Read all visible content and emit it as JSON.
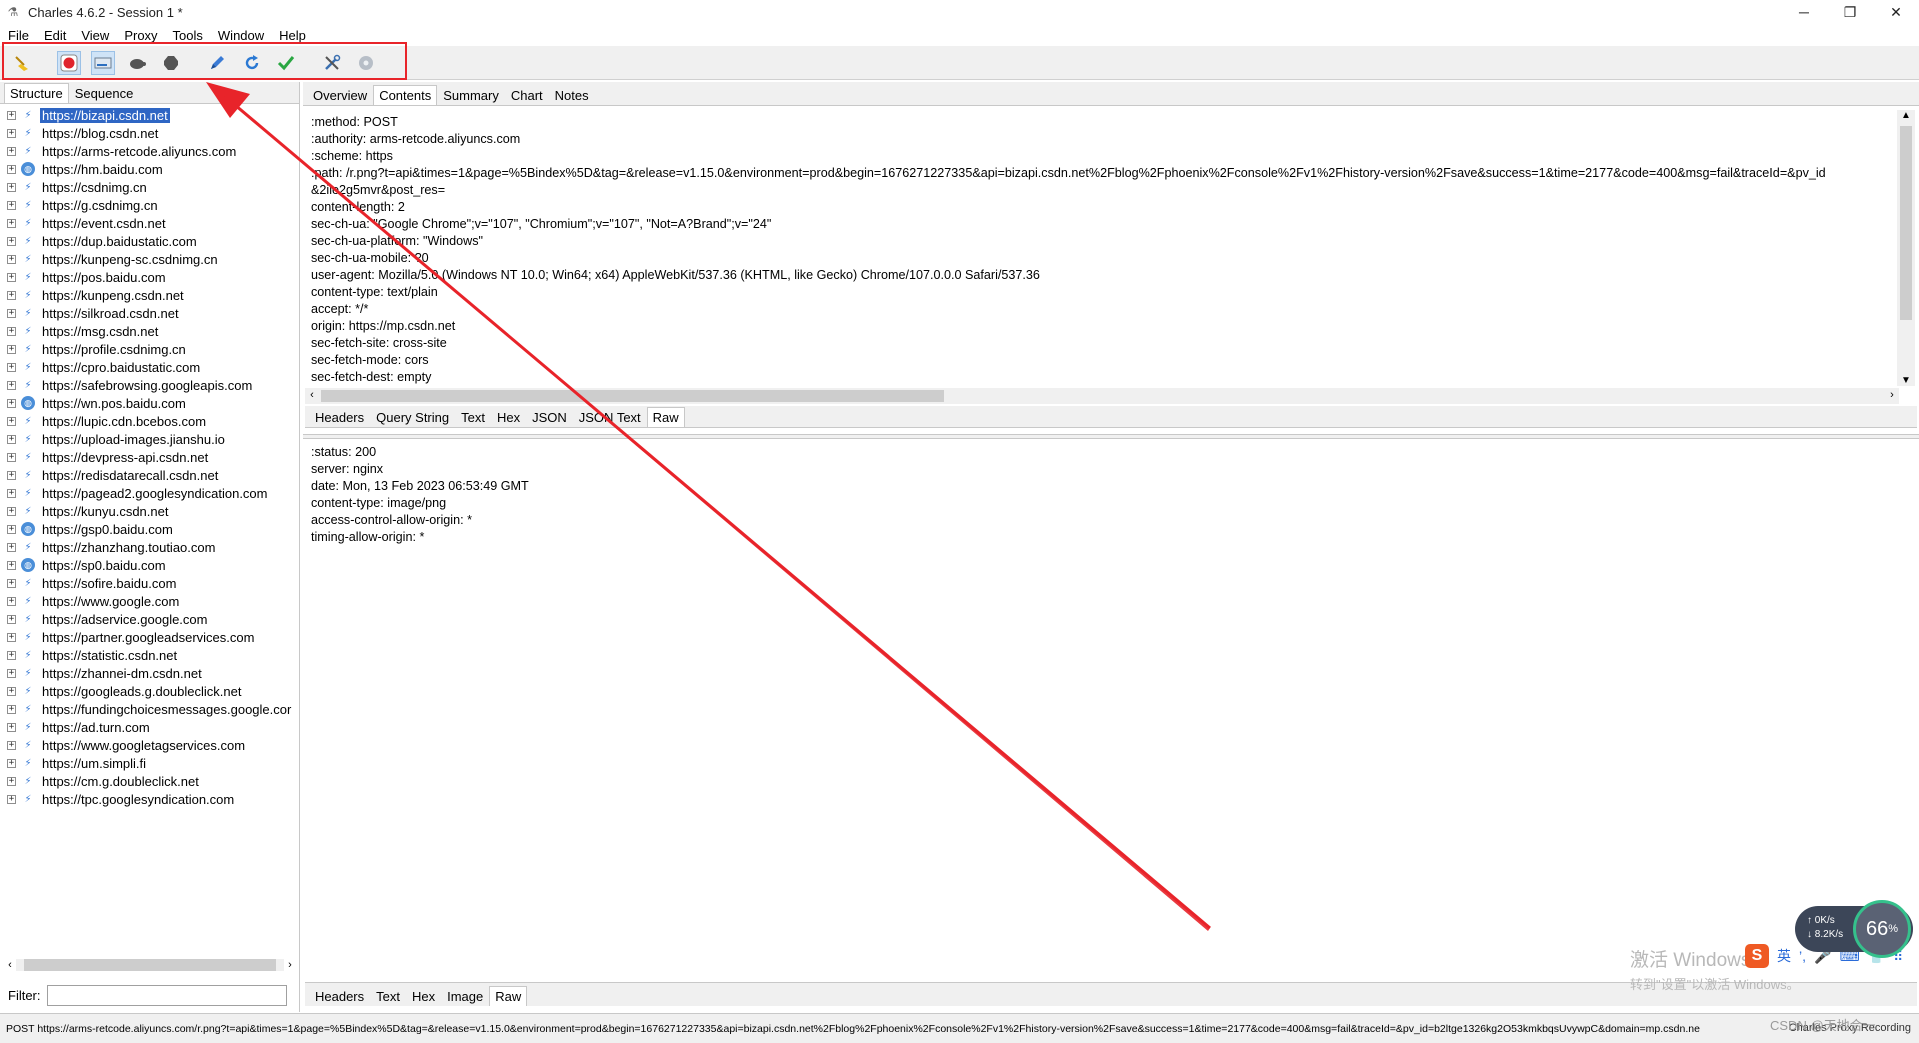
{
  "window": {
    "title": "Charles 4.6.2 - Session 1 *",
    "minimize": "─",
    "restore": "❐",
    "close": "✕"
  },
  "menu": [
    "File",
    "Edit",
    "View",
    "Proxy",
    "Tools",
    "Window",
    "Help"
  ],
  "toolbar": {
    "buttons": [
      "broom-icon",
      "record-icon",
      "throttle-icon",
      "turtle-icon",
      "stop-hexagon-icon",
      "pen-icon",
      "refresh-icon",
      "checkmark-icon",
      "tools-icon",
      "settings-icon"
    ],
    "highlight_color": "#e8242a"
  },
  "left": {
    "tabs": [
      "Structure",
      "Sequence"
    ],
    "tree": [
      {
        "label": "https://bizapi.csdn.net",
        "icon": "bolt-icon",
        "selected": true
      },
      {
        "label": "https://blog.csdn.net",
        "icon": "bolt-icon"
      },
      {
        "label": "https://arms-retcode.aliyuncs.com",
        "icon": "bolt-icon"
      },
      {
        "label": "https://hm.baidu.com",
        "icon": "globe-icon"
      },
      {
        "label": "https://csdnimg.cn",
        "icon": "bolt-icon"
      },
      {
        "label": "https://g.csdnimg.cn",
        "icon": "bolt-icon"
      },
      {
        "label": "https://event.csdn.net",
        "icon": "bolt-icon"
      },
      {
        "label": "https://dup.baidustatic.com",
        "icon": "bolt-icon"
      },
      {
        "label": "https://kunpeng-sc.csdnimg.cn",
        "icon": "bolt-icon"
      },
      {
        "label": "https://pos.baidu.com",
        "icon": "bolt-icon"
      },
      {
        "label": "https://kunpeng.csdn.net",
        "icon": "bolt-icon"
      },
      {
        "label": "https://silkroad.csdn.net",
        "icon": "bolt-icon"
      },
      {
        "label": "https://msg.csdn.net",
        "icon": "bolt-icon"
      },
      {
        "label": "https://profile.csdnimg.cn",
        "icon": "bolt-icon"
      },
      {
        "label": "https://cpro.baidustatic.com",
        "icon": "bolt-icon"
      },
      {
        "label": "https://safebrowsing.googleapis.com",
        "icon": "bolt-icon"
      },
      {
        "label": "https://wn.pos.baidu.com",
        "icon": "globe-icon"
      },
      {
        "label": "https://lupic.cdn.bcebos.com",
        "icon": "bolt-icon"
      },
      {
        "label": "https://upload-images.jianshu.io",
        "icon": "bolt-icon"
      },
      {
        "label": "https://devpress-api.csdn.net",
        "icon": "bolt-icon"
      },
      {
        "label": "https://redisdatarecall.csdn.net",
        "icon": "bolt-icon"
      },
      {
        "label": "https://pagead2.googlesyndication.com",
        "icon": "bolt-icon"
      },
      {
        "label": "https://kunyu.csdn.net",
        "icon": "bolt-icon"
      },
      {
        "label": "https://gsp0.baidu.com",
        "icon": "globe-icon"
      },
      {
        "label": "https://zhanzhang.toutiao.com",
        "icon": "bolt-icon"
      },
      {
        "label": "https://sp0.baidu.com",
        "icon": "globe-icon"
      },
      {
        "label": "https://sofire.baidu.com",
        "icon": "bolt-icon"
      },
      {
        "label": "https://www.google.com",
        "icon": "bolt-icon"
      },
      {
        "label": "https://adservice.google.com",
        "icon": "bolt-icon"
      },
      {
        "label": "https://partner.googleadservices.com",
        "icon": "bolt-icon"
      },
      {
        "label": "https://statistic.csdn.net",
        "icon": "bolt-icon"
      },
      {
        "label": "https://zhannei-dm.csdn.net",
        "icon": "bolt-icon"
      },
      {
        "label": "https://googleads.g.doubleclick.net",
        "icon": "bolt-icon"
      },
      {
        "label": "https://fundingchoicesmessages.google.cor",
        "icon": "bolt-icon"
      },
      {
        "label": "https://ad.turn.com",
        "icon": "bolt-icon"
      },
      {
        "label": "https://www.googletagservices.com",
        "icon": "bolt-icon"
      },
      {
        "label": "https://um.simpli.fi",
        "icon": "bolt-icon"
      },
      {
        "label": "https://cm.g.doubleclick.net",
        "icon": "bolt-icon"
      },
      {
        "label": "https://tpc.googlesyndication.com",
        "icon": "bolt-icon"
      }
    ],
    "filter_label": "Filter:",
    "filter_value": ""
  },
  "right": {
    "tabs": [
      "Overview",
      "Contents",
      "Summary",
      "Chart",
      "Notes"
    ],
    "active_tab": "Contents",
    "request_lines": [
      ":method: POST",
      ":authority: arms-retcode.aliyuncs.com",
      ":scheme: https",
      ":path: /r.png?t=api&times=1&page=%5Bindex%5D&tag=&release=v1.15.0&environment=prod&begin=1676271227335&api=bizapi.csdn.net%2Fblog%2Fphoenix%2Fconsole%2Fv1%2Fhistory-version%2Fsave&success=1&time=2177&code=400&msg=fail&traceId=&pv_id",
      "&2ile2g5mvr&post_res=",
      "content-length: 2",
      "sec-ch-ua: \"Google Chrome\";v=\"107\", \"Chromium\";v=\"107\", \"Not=A?Brand\";v=\"24\"",
      "sec-ch-ua-platform: \"Windows\"",
      "sec-ch-ua-mobile: ?0",
      "user-agent: Mozilla/5.0 (Windows NT 10.0; Win64; x64) AppleWebKit/537.36 (KHTML, like Gecko) Chrome/107.0.0.0 Safari/537.36",
      "content-type: text/plain",
      "accept: */*",
      "origin: https://mp.csdn.net",
      "sec-fetch-site: cross-site",
      "sec-fetch-mode: cors",
      "sec-fetch-dest: empty"
    ],
    "request_subtabs": [
      "Headers",
      "Query String",
      "Text",
      "Hex",
      "JSON",
      "JSON Text",
      "Raw"
    ],
    "request_active_subtab": "Raw",
    "response_lines": [
      ":status: 200",
      "server: nginx",
      "date: Mon, 13 Feb 2023 06:53:49 GMT",
      "content-type: image/png",
      "access-control-allow-origin: *",
      "timing-allow-origin: *"
    ],
    "response_subtabs": [
      "Headers",
      "Text",
      "Hex",
      "Image",
      "Raw"
    ],
    "response_active_subtab": "Raw"
  },
  "statusbar": {
    "url": "POST https://arms-retcode.aliyuncs.com/r.png?t=api&times=1&page=%5Bindex%5D&tag=&release=v1.15.0&environment=prod&begin=1676271227335&api=bizapi.csdn.net%2Fblog%2Fphoenix%2Fconsole%2Fv1%2Fhistory-version%2Fsave&success=1&time=2177&code=400&msg=fail&traceId=&pv_id=b2ltge1326kg2O53kmkbqsUvywpC&domain=mp.csdn.ne",
    "right_text": "Charles Proxy   Recording"
  },
  "overlays": {
    "watermark_line1": "激活 Windows",
    "watermark_line2": "转到\"设置\"以激活 Windows。",
    "ime_label": "S",
    "ime_mode": "英",
    "net_up": "0",
    "net_up_unit": "K/s",
    "net_down": "8.2",
    "net_down_unit": "K/s",
    "cpu": "66",
    "cpu_unit": "%",
    "csdn_mark": "CSDN @天地合一",
    "annotation_color": "#e8242a"
  }
}
